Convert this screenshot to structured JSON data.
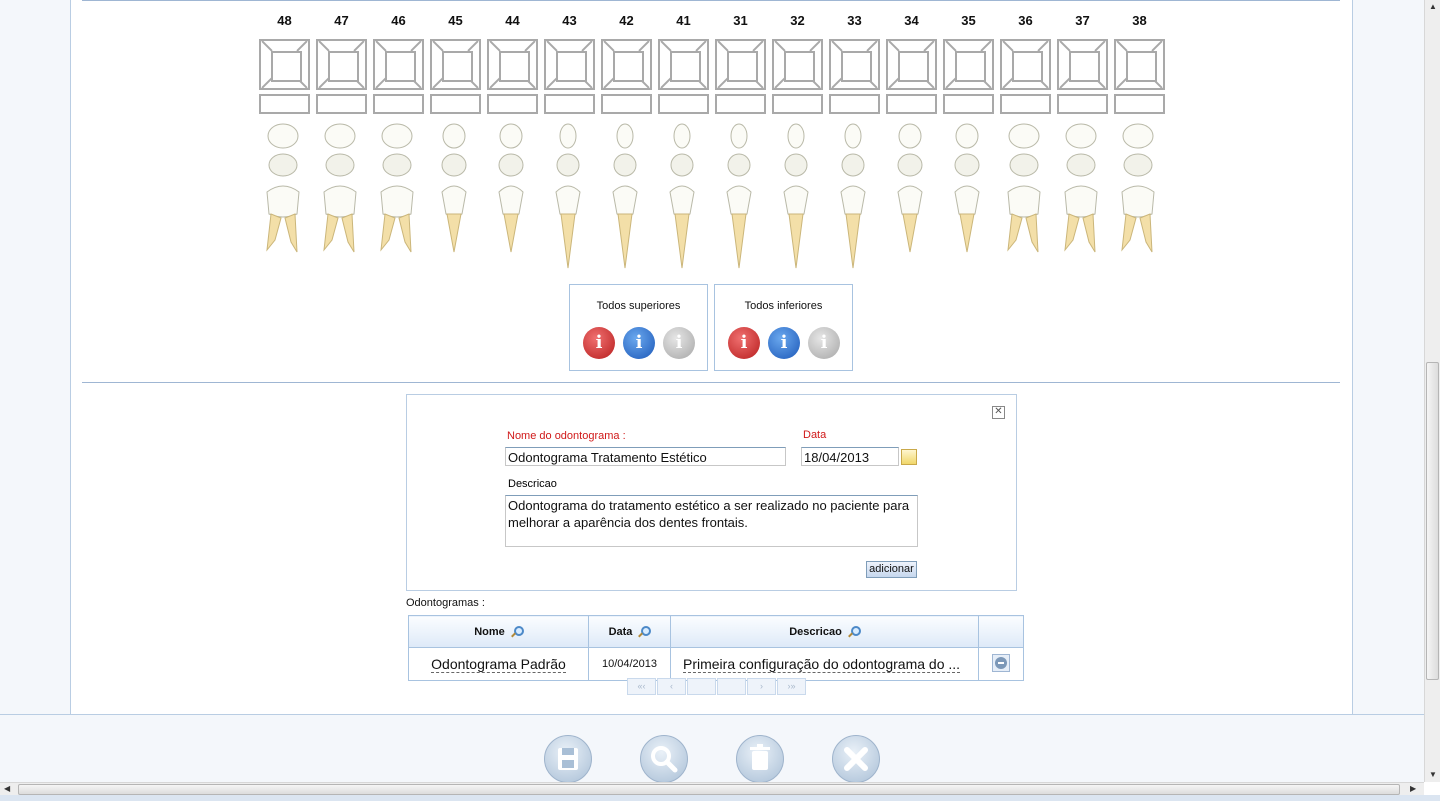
{
  "teeth": [
    "48",
    "47",
    "46",
    "45",
    "44",
    "43",
    "42",
    "41",
    "31",
    "32",
    "33",
    "34",
    "35",
    "36",
    "37",
    "38"
  ],
  "selectors": [
    {
      "title": "Todos superiores"
    },
    {
      "title": "Todos inferiores"
    }
  ],
  "icon_glyph": "i",
  "form": {
    "name_label": "Nome do odontograma :",
    "name_value": "Odontograma Tratamento Estético",
    "date_label": "Data",
    "date_value": "18/04/2013",
    "desc_label": "Descricao",
    "desc_value": "Odontograma do tratamento estético a ser realizado no paciente para melhorar a aparência dos dentes frontais.",
    "add_button": "adicionar",
    "close_glyph": "✕"
  },
  "list": {
    "label": "Odontogramas :",
    "columns": [
      "Nome",
      "Data",
      "Descricao"
    ],
    "rows": [
      {
        "nome": "Odontograma Padrão",
        "data": "10/04/2013",
        "descricao": "Primeira configuração do odontograma do ..."
      }
    ]
  },
  "pager": [
    "«‹",
    "‹",
    "",
    "",
    "›",
    "›»"
  ],
  "colors": {
    "required_label": "#d01919",
    "border_blue": "#a8c3e0",
    "icon_red": "#b71d1d",
    "icon_blue": "#1c58b8",
    "icon_grey": "#a6a6a6"
  },
  "toolbar_icons": [
    "save-icon",
    "search-icon",
    "delete-icon",
    "close-icon"
  ]
}
